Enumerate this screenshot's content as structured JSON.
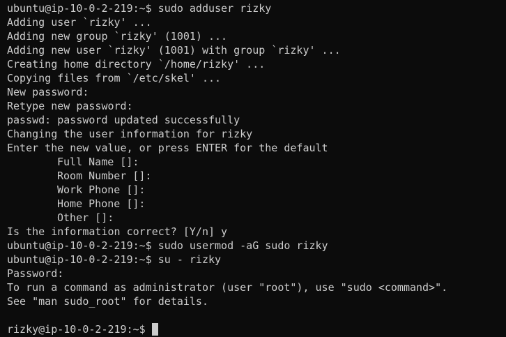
{
  "terminal": {
    "lines": [
      {
        "text": "ubuntu@ip-10-0-2-219:~$ sudo adduser rizky",
        "indent": false
      },
      {
        "text": "Adding user `rizky' ...",
        "indent": false
      },
      {
        "text": "Adding new group `rizky' (1001) ...",
        "indent": false
      },
      {
        "text": "Adding new user `rizky' (1001) with group `rizky' ...",
        "indent": false
      },
      {
        "text": "Creating home directory `/home/rizky' ...",
        "indent": false
      },
      {
        "text": "Copying files from `/etc/skel' ...",
        "indent": false
      },
      {
        "text": "New password:",
        "indent": false
      },
      {
        "text": "Retype new password:",
        "indent": false
      },
      {
        "text": "passwd: password updated successfully",
        "indent": false
      },
      {
        "text": "Changing the user information for rizky",
        "indent": false
      },
      {
        "text": "Enter the new value, or press ENTER for the default",
        "indent": false
      },
      {
        "text": "Full Name []:",
        "indent": true
      },
      {
        "text": "Room Number []:",
        "indent": true
      },
      {
        "text": "Work Phone []:",
        "indent": true
      },
      {
        "text": "Home Phone []:",
        "indent": true
      },
      {
        "text": "Other []:",
        "indent": true
      },
      {
        "text": "Is the information correct? [Y/n] y",
        "indent": false
      },
      {
        "text": "ubuntu@ip-10-0-2-219:~$ sudo usermod -aG sudo rizky",
        "indent": false
      },
      {
        "text": "ubuntu@ip-10-0-2-219:~$ su - rizky",
        "indent": false
      },
      {
        "text": "Password:",
        "indent": false
      },
      {
        "text": "To run a command as administrator (user \"root\"), use \"sudo <command>\".",
        "indent": false
      },
      {
        "text": "See \"man sudo_root\" for details.",
        "indent": false
      },
      {
        "text": "",
        "indent": false
      }
    ],
    "current_prompt": "rizky@ip-10-0-2-219:~$",
    "colors": {
      "background": "#0c0c0c",
      "foreground": "#cccccc"
    }
  }
}
